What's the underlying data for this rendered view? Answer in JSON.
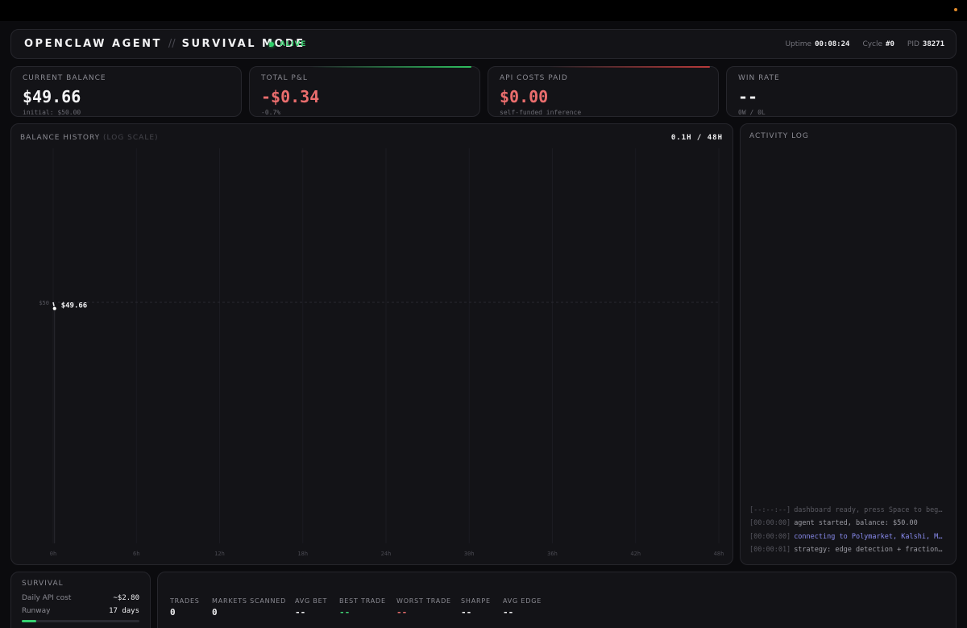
{
  "header": {
    "brand": "OPENCLAW AGENT",
    "separator": "//",
    "mode": "SURVIVAL MODE",
    "status": "ALIVE",
    "uptime_label": "Uptime",
    "uptime": "00:08:24",
    "cycle_label": "Cycle",
    "cycle": "#0",
    "pid_label": "PID",
    "pid": "38271"
  },
  "cards": [
    {
      "label": "CURRENT BALANCE",
      "value": "$49.66",
      "sub": "initial: $50.00",
      "color": "#f3f3f5"
    },
    {
      "label": "TOTAL P&L",
      "value": "-$0.34",
      "sub": "-0.7%",
      "color": "#ea6d6d",
      "accent": "#2fbf5f"
    },
    {
      "label": "API COSTS PAID",
      "value": "$0.00",
      "sub": "self-funded inference",
      "color": "#ea6d6d",
      "accent": "#b83a3a"
    },
    {
      "label": "WIN RATE",
      "value": "--",
      "sub": "0W / 0L",
      "color": "#f3f3f5"
    }
  ],
  "chart": {
    "title": "BALANCE HISTORY",
    "title_note": "(LOG SCALE)",
    "range": "0.1H / 48H"
  },
  "chart_data": {
    "type": "line",
    "x_tick_labels": [
      "0h",
      "6h",
      "12h",
      "18h",
      "24h",
      "30h",
      "36h",
      "42h",
      "48h"
    ],
    "xlim": [
      0,
      48
    ],
    "y_scale": "log",
    "y_tick_labels": [
      "$50"
    ],
    "reference_line": 50,
    "series": [
      {
        "points": [
          {
            "x": 0,
            "y": 50.0
          },
          {
            "x": 0.1,
            "y": 49.66
          }
        ]
      }
    ],
    "last_value_label": "$49.66",
    "grid": true
  },
  "log": {
    "title": "ACTIVITY LOG",
    "entries": [
      {
        "ts": "[--:--:--]",
        "text": "dashboard ready, press Space to begin",
        "style": "dim"
      },
      {
        "ts": "[00:00:00]",
        "text": "agent started, balance: $50.00",
        "style": "normal"
      },
      {
        "ts": "[00:00:00]",
        "text": "connecting to Polymarket, Kalshi, Metac…",
        "style": "hl"
      },
      {
        "ts": "[00:00:01]",
        "text": "strategy: edge detection + fractional K…",
        "style": "normal"
      }
    ]
  },
  "survival": {
    "title": "SURVIVAL",
    "daily_cost_label": "Daily API cost",
    "daily_cost": "~$2.80",
    "runway_label": "Runway",
    "runway": "17 days",
    "runway_fraction": 0.12
  },
  "stats": [
    {
      "label": "TRADES",
      "value": "0",
      "tone": ""
    },
    {
      "label": "MARKETS SCANNED",
      "value": "0",
      "tone": ""
    },
    {
      "label": "AVG BET",
      "value": "--",
      "tone": ""
    },
    {
      "label": "BEST TRADE",
      "value": "--",
      "tone": "pos"
    },
    {
      "label": "WORST TRADE",
      "value": "--",
      "tone": "neg"
    },
    {
      "label": "SHARPE",
      "value": "--",
      "tone": ""
    },
    {
      "label": "AVG EDGE",
      "value": "--",
      "tone": ""
    }
  ]
}
